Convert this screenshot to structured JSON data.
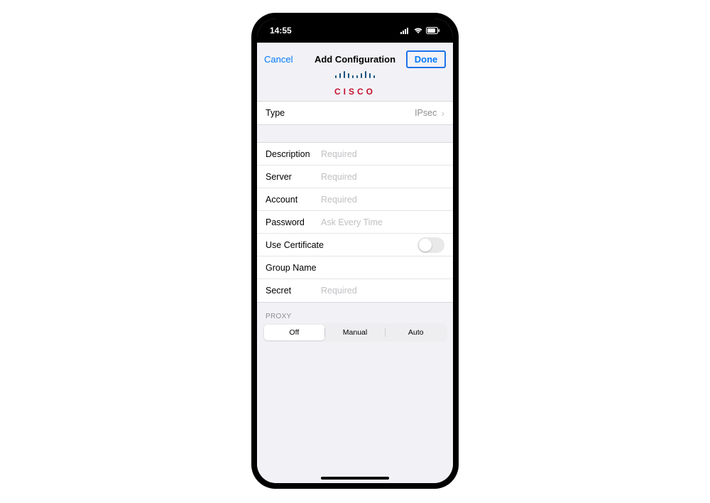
{
  "status": {
    "time": "14:55"
  },
  "nav": {
    "cancel": "Cancel",
    "title": "Add Configuration",
    "done": "Done"
  },
  "logo": {
    "brand": "CISCO"
  },
  "type_row": {
    "label": "Type",
    "value": "IPsec"
  },
  "fields": {
    "description": {
      "label": "Description",
      "placeholder": "Required"
    },
    "server": {
      "label": "Server",
      "placeholder": "Required"
    },
    "account": {
      "label": "Account",
      "placeholder": "Required"
    },
    "password": {
      "label": "Password",
      "placeholder": "Ask Every Time"
    },
    "certificate": {
      "label": "Use Certificate"
    },
    "group": {
      "label": "Group Name"
    },
    "secret": {
      "label": "Secret",
      "placeholder": "Required"
    }
  },
  "proxy": {
    "header": "Proxy",
    "options": [
      "Off",
      "Manual",
      "Auto"
    ],
    "selected": "Off"
  }
}
